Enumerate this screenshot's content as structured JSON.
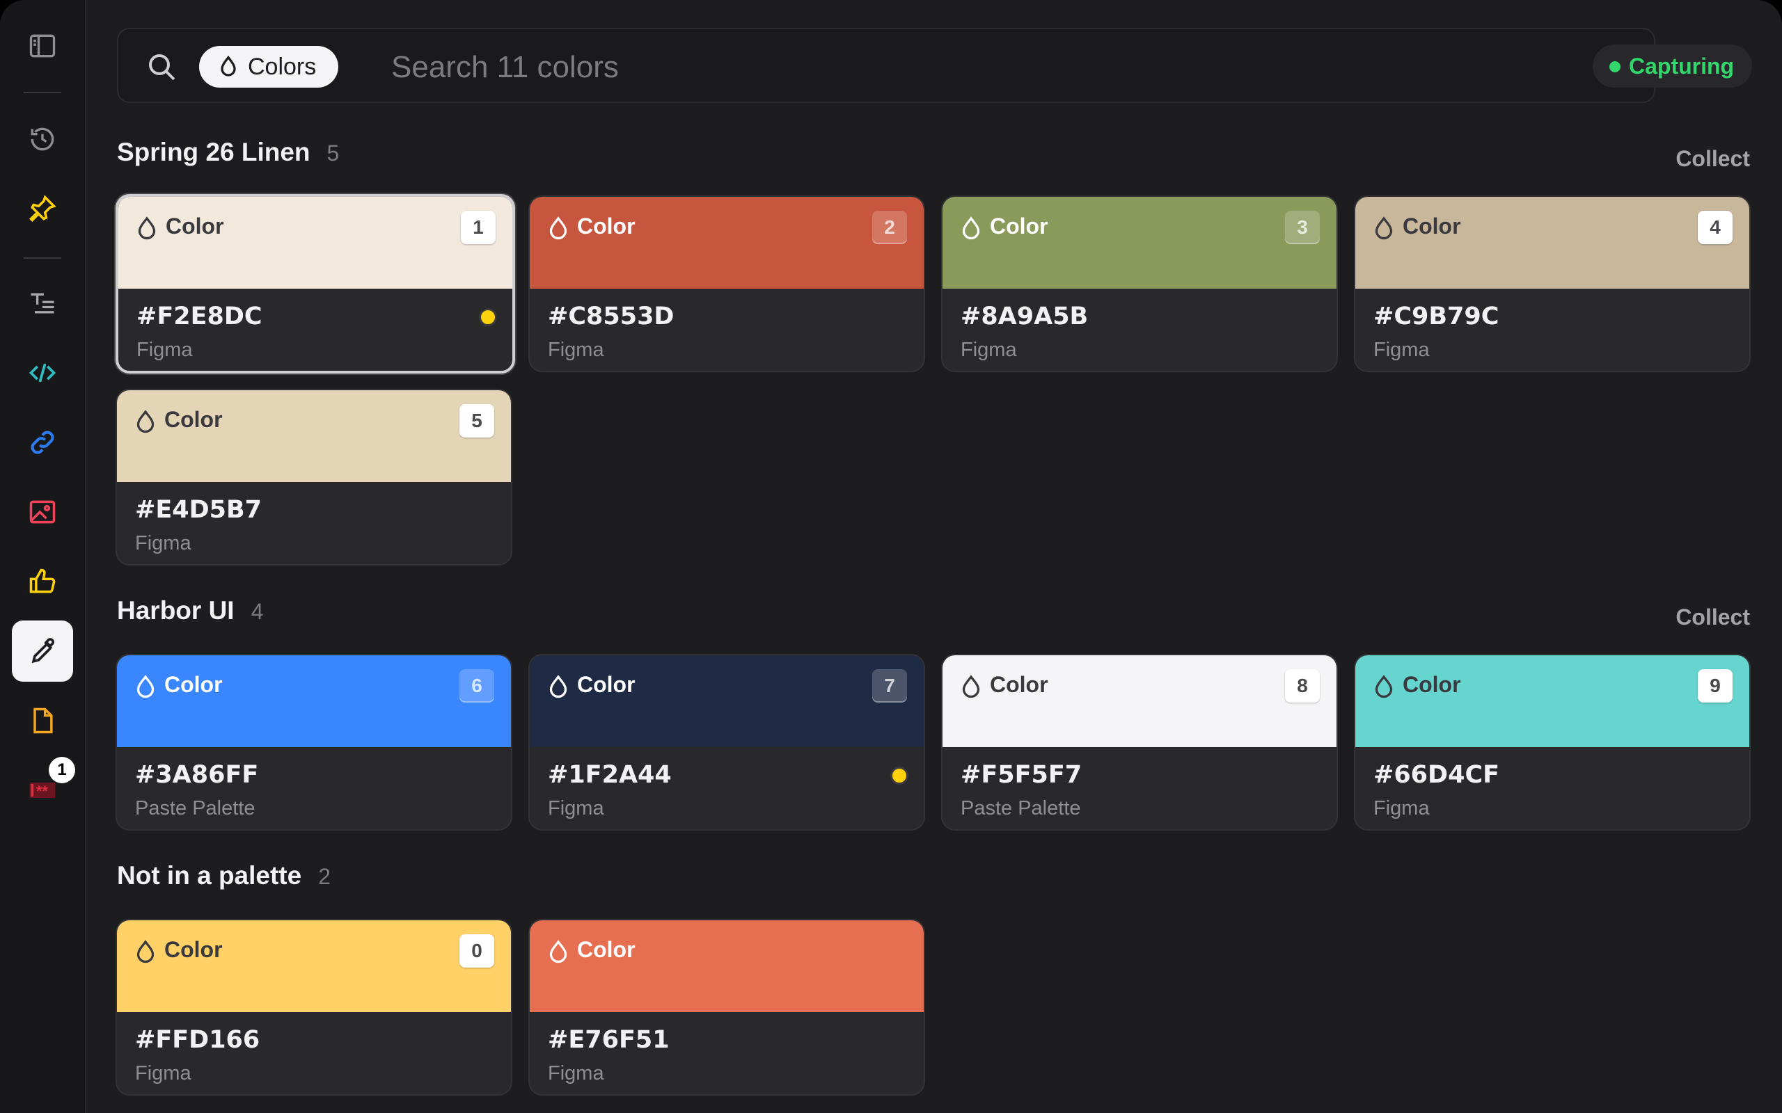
{
  "search": {
    "chip_label": "Colors",
    "placeholder": "Search 11 colors",
    "status": "Capturing"
  },
  "sidebar": {
    "badge": "1"
  },
  "sections": [
    {
      "title": "Spring 26 Linen",
      "count": "5",
      "action": "Collect"
    },
    {
      "title": "Harbor UI",
      "count": "4",
      "action": "Collect"
    },
    {
      "title": "Not in a palette",
      "count": "2"
    }
  ],
  "cards": [
    {
      "label": "Color",
      "num": "1",
      "hex": "#F2E8DC",
      "source": "Figma",
      "color": "#F2E8DC"
    },
    {
      "label": "Color",
      "num": "2",
      "hex": "#C8553D",
      "source": "Figma",
      "color": "#C8553D"
    },
    {
      "label": "Color",
      "num": "3",
      "hex": "#8A9A5B",
      "source": "Figma",
      "color": "#8A9A5B"
    },
    {
      "label": "Color",
      "num": "4",
      "hex": "#C9B79C",
      "source": "Figma",
      "color": "#C9B79C"
    },
    {
      "label": "Color",
      "num": "5",
      "hex": "#E4D5B7",
      "source": "Figma",
      "color": "#E4D5B7"
    },
    {
      "label": "Color",
      "num": "6",
      "hex": "#3A86FF",
      "source": "Paste Palette",
      "color": "#3A86FF"
    },
    {
      "label": "Color",
      "num": "7",
      "hex": "#1F2A44",
      "source": "Figma",
      "color": "#1F2A44"
    },
    {
      "label": "Color",
      "num": "8",
      "hex": "#F5F5F7",
      "source": "Paste Palette",
      "color": "#F5F5F7"
    },
    {
      "label": "Color",
      "num": "9",
      "hex": "#66D4CF",
      "source": "Figma",
      "color": "#66D4CF"
    },
    {
      "label": "Color",
      "num": "0",
      "hex": "#FFD166",
      "source": "Figma",
      "color": "#FFD166"
    },
    {
      "label": "Color",
      "hex": "#E76F51",
      "source": "Figma",
      "color": "#E76F51"
    }
  ],
  "colors": {
    "capturing": "#33D66B",
    "flag_dot": "#FFD10A",
    "window_bg": "#1D1D20"
  },
  "icons": [
    "sidebar-toggle-icon",
    "history-icon",
    "pin-icon",
    "text-icon",
    "code-icon",
    "link-icon",
    "image-icon",
    "thumbs-up-icon",
    "eyedropper-icon",
    "document-icon",
    "password-icon",
    "search-icon",
    "drop-icon"
  ]
}
